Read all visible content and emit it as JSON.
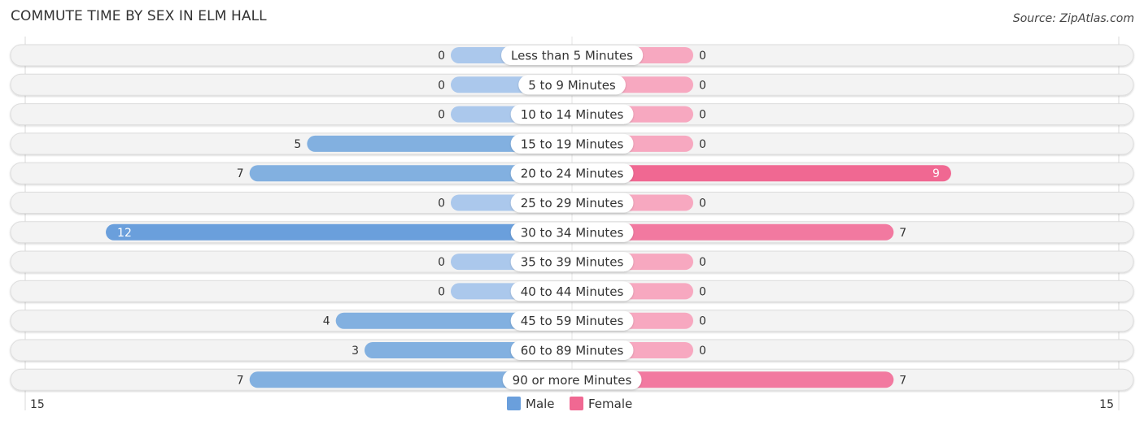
{
  "title": "COMMUTE TIME BY SEX IN ELM HALL",
  "source": "Source: ZipAtlas.com",
  "colors": {
    "male": "#6a9fdc",
    "male_light": "#abc8ec",
    "female": "#f06892",
    "female_light": "#f7a8c0",
    "row_bg": "#f3f3f3",
    "row_border": "#dddddd"
  },
  "chart_data": {
    "type": "bar",
    "orientation": "horizontal-diverging",
    "title": "COMMUTE TIME BY SEX IN ELM HALL",
    "categories": [
      "Less than 5 Minutes",
      "5 to 9 Minutes",
      "10 to 14 Minutes",
      "15 to 19 Minutes",
      "20 to 24 Minutes",
      "25 to 29 Minutes",
      "30 to 34 Minutes",
      "35 to 39 Minutes",
      "40 to 44 Minutes",
      "45 to 59 Minutes",
      "60 to 89 Minutes",
      "90 or more Minutes"
    ],
    "series": [
      {
        "name": "Male",
        "values": [
          0,
          0,
          0,
          5,
          7,
          0,
          12,
          0,
          0,
          4,
          3,
          7
        ]
      },
      {
        "name": "Female",
        "values": [
          0,
          0,
          0,
          0,
          9,
          0,
          7,
          0,
          0,
          0,
          0,
          7
        ]
      }
    ],
    "axis": {
      "left_label": "15",
      "right_label": "15",
      "max": 15
    },
    "legend": {
      "position": "bottom-center",
      "items": [
        "Male",
        "Female"
      ]
    }
  }
}
